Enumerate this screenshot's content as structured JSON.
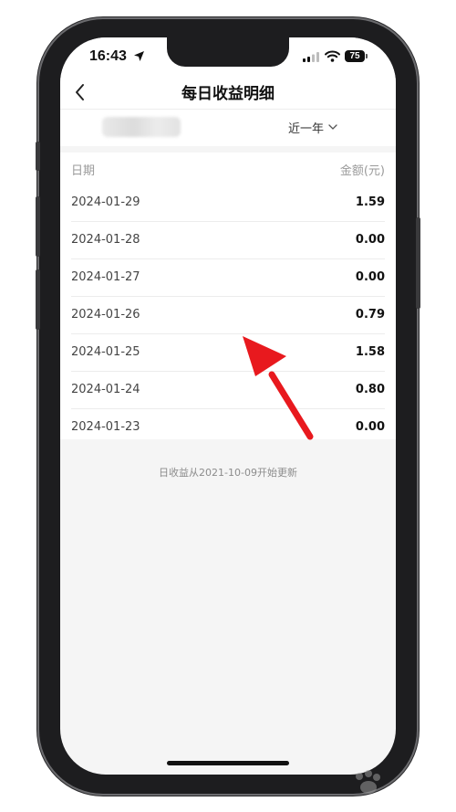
{
  "status_bar": {
    "time": "16:43",
    "battery": "75"
  },
  "nav": {
    "title": "每日收益明细"
  },
  "filter": {
    "range": "近一年"
  },
  "table": {
    "headers": {
      "date": "日期",
      "amount": "金额(元)"
    },
    "rows": [
      {
        "date": "2024-01-29",
        "amount": "1.59"
      },
      {
        "date": "2024-01-28",
        "amount": "0.00"
      },
      {
        "date": "2024-01-27",
        "amount": "0.00"
      },
      {
        "date": "2024-01-26",
        "amount": "0.79"
      },
      {
        "date": "2024-01-25",
        "amount": "1.58"
      },
      {
        "date": "2024-01-24",
        "amount": "0.80"
      },
      {
        "date": "2024-01-23",
        "amount": "0.00"
      }
    ]
  },
  "footer": {
    "note": "日收益从2021-10-09开始更新"
  },
  "colors": {
    "annotation_arrow": "#e8191e",
    "page_bg": "#f5f5f5"
  },
  "icons": {
    "back": "chevron-left-icon",
    "range": "chevron-down-icon",
    "location": "location-arrow-icon",
    "wifi": "wifi-icon",
    "signal": "signal-icon"
  }
}
